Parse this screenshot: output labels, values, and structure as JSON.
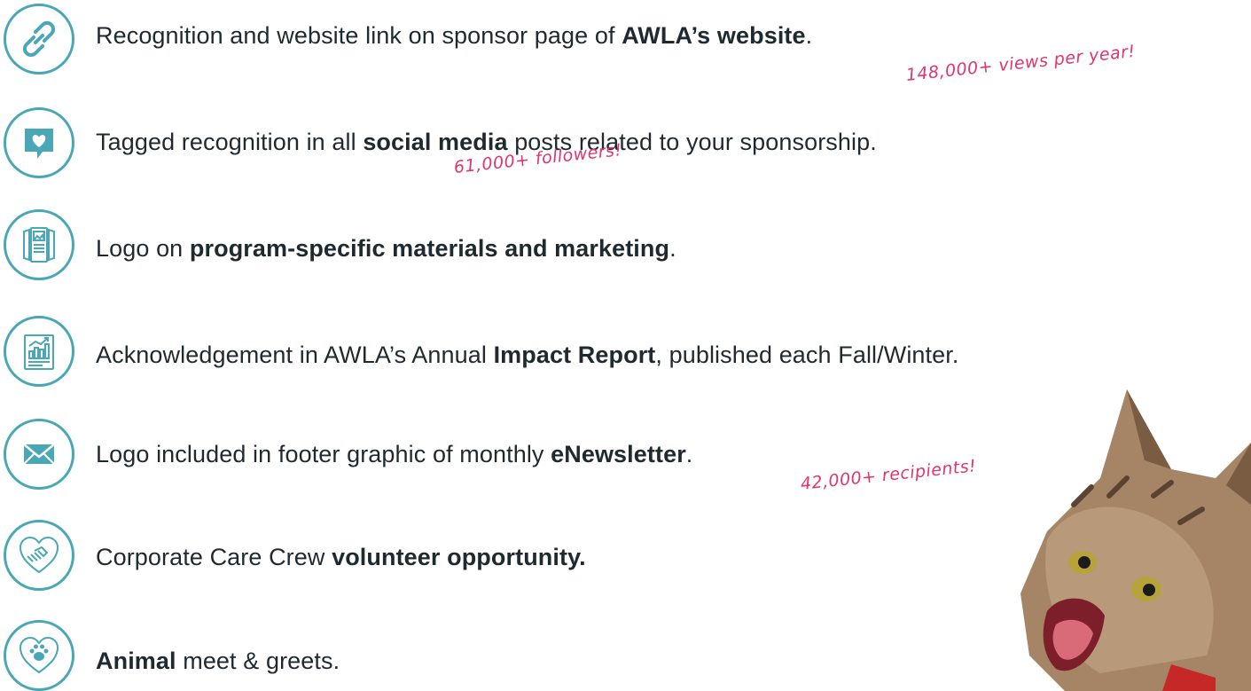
{
  "benefits": [
    {
      "icon": "link-icon",
      "pre": "Recognition and website link on sponsor page of ",
      "bold": "AWLA’s website",
      "post": ".",
      "note": "148,000+ views per year!"
    },
    {
      "icon": "heart-chat-icon",
      "pre": "Tagged recognition in all ",
      "bold": "social media",
      "post": " posts related to your sponsorship.",
      "note": "61,000+ followers!"
    },
    {
      "icon": "brochure-icon",
      "pre": "Logo on ",
      "bold": "program-specific materials and marketing",
      "post": ".",
      "note": ""
    },
    {
      "icon": "report-chart-icon",
      "pre": "Acknowledgement in AWLA’s Annual ",
      "bold": "Impact Report",
      "post": ", published each Fall/Winter.",
      "note": ""
    },
    {
      "icon": "envelope-icon",
      "pre": "Logo included in footer graphic of monthly ",
      "bold": "eNewsletter",
      "post": ".",
      "note": "42,000+ recipients!"
    },
    {
      "icon": "handshake-heart-icon",
      "pre": "Corporate Care Crew ",
      "bold": "volunteer opportunity.",
      "post": "",
      "note": ""
    },
    {
      "icon": "paw-heart-icon",
      "pre": "",
      "bold": "Animal",
      "post": " meet & greets.",
      "note": ""
    }
  ],
  "colors": {
    "accent": "#4aa7b5",
    "note": "#e0356e",
    "text": "#1f2a30"
  }
}
